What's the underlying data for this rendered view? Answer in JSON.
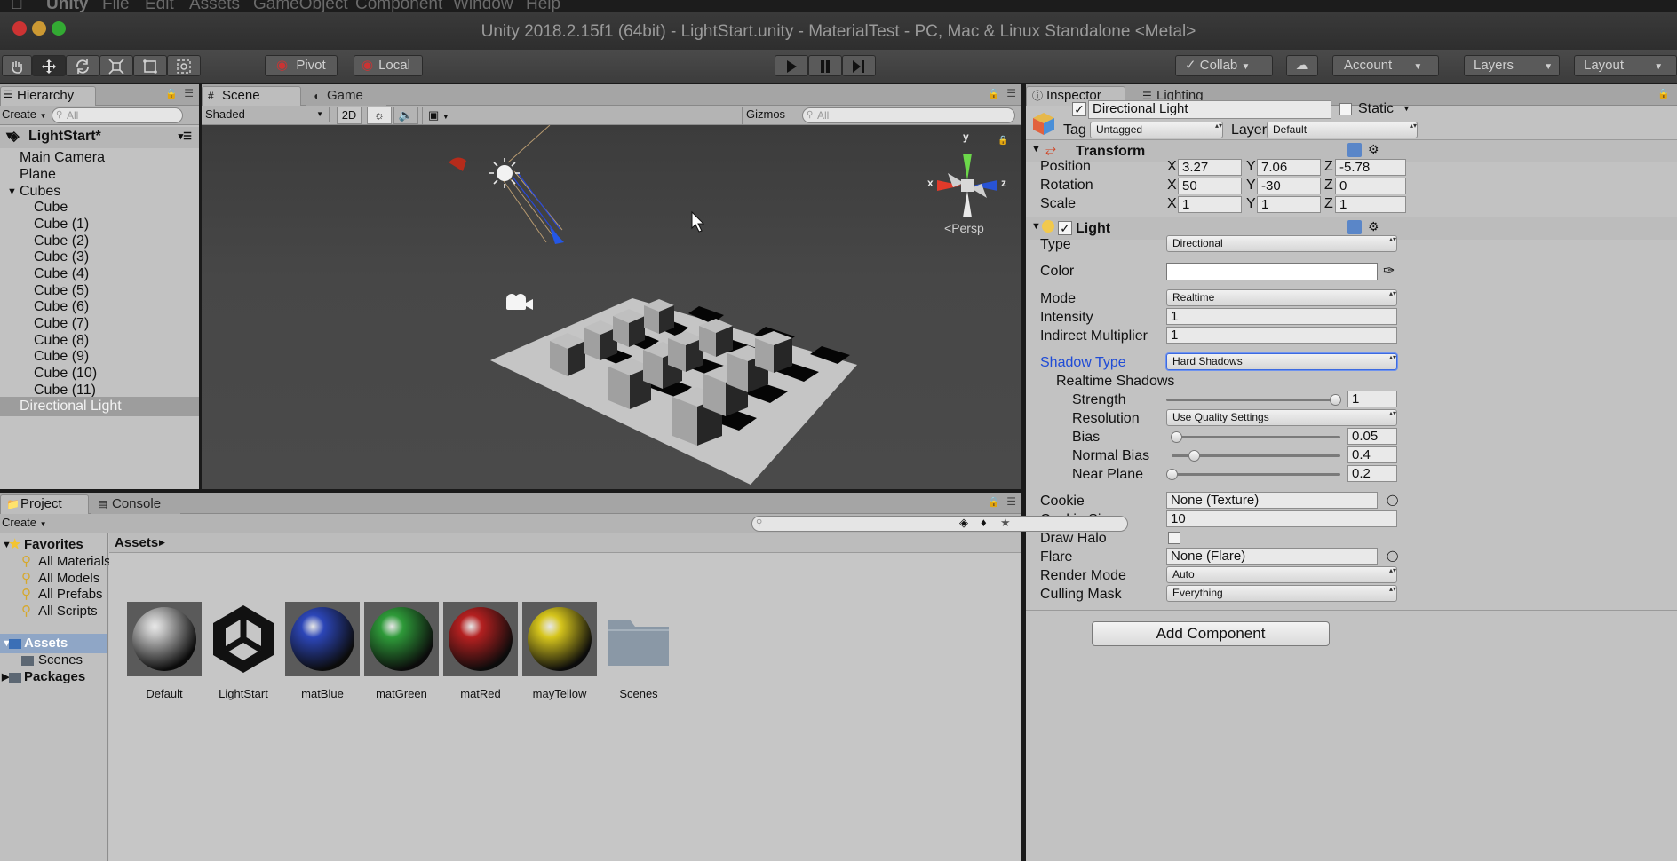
{
  "menubar": {
    "app": "Unity",
    "items": [
      "File",
      "Edit",
      "Assets",
      "GameObject",
      "Component",
      "Window",
      "Help"
    ]
  },
  "window": {
    "title": "Unity 2018.2.15f1 (64bit) - LightStart.unity - MaterialTest - PC, Mac & Linux Standalone <Metal>"
  },
  "toolbar": {
    "pivot": "Pivot",
    "local": "Local",
    "collab": "Collab",
    "account": "Account",
    "layers": "Layers",
    "layout": "Layout"
  },
  "hierarchy": {
    "tab": "Hierarchy",
    "create": "Create",
    "search_placeholder": "All",
    "scene": "LightStart*",
    "items": [
      "Main Camera",
      "Plane",
      "Cubes",
      "Cube",
      "Cube (1)",
      "Cube (2)",
      "Cube (3)",
      "Cube (4)",
      "Cube (5)",
      "Cube (6)",
      "Cube (7)",
      "Cube (8)",
      "Cube (9)",
      "Cube (10)",
      "Cube (11)",
      "Directional Light"
    ],
    "selected": "Directional Light"
  },
  "scene": {
    "tabs": [
      "Scene",
      "Game"
    ],
    "draw_mode": "Shaded",
    "mode_2d": "2D",
    "gizmos": "Gizmos",
    "search_placeholder": "All",
    "gizmo_axes": {
      "y": "y",
      "x": "x",
      "z": "z"
    },
    "persp": "Persp"
  },
  "inspector": {
    "tabs": [
      "Inspector",
      "Lighting"
    ],
    "object_name": "Directional Light",
    "static": "Static",
    "tag_label": "Tag",
    "tag_value": "Untagged",
    "layer_label": "Layer",
    "layer_value": "Default",
    "transform": {
      "title": "Transform",
      "position": {
        "label": "Position",
        "x": "3.27",
        "y": "7.06",
        "z": "-5.78"
      },
      "rotation": {
        "label": "Rotation",
        "x": "50",
        "y": "-30",
        "z": "0"
      },
      "scale": {
        "label": "Scale",
        "x": "1",
        "y": "1",
        "z": "1"
      },
      "axes": [
        "X",
        "Y",
        "Z"
      ]
    },
    "light": {
      "title": "Light",
      "type_label": "Type",
      "type_value": "Directional",
      "color_label": "Color",
      "mode_label": "Mode",
      "mode_value": "Realtime",
      "intensity_label": "Intensity",
      "intensity_value": "1",
      "indirect_label": "Indirect Multiplier",
      "indirect_value": "1",
      "shadow_type_label": "Shadow Type",
      "shadow_type_value": "Hard Shadows",
      "realtime_shadows": "Realtime Shadows",
      "strength_label": "Strength",
      "strength_value": "1",
      "resolution_label": "Resolution",
      "resolution_value": "Use Quality Settings",
      "bias_label": "Bias",
      "bias_value": "0.05",
      "normal_bias_label": "Normal Bias",
      "normal_bias_value": "0.4",
      "near_plane_label": "Near Plane",
      "near_plane_value": "0.2",
      "cookie_label": "Cookie",
      "cookie_value": "None (Texture)",
      "cookie_size_label": "Cookie Size",
      "cookie_size_value": "10",
      "draw_halo_label": "Draw Halo",
      "flare_label": "Flare",
      "flare_value": "None (Flare)",
      "render_mode_label": "Render Mode",
      "render_mode_value": "Auto",
      "culling_mask_label": "Culling Mask",
      "culling_mask_value": "Everything",
      "slider_levels": {
        "strength": 1.0,
        "bias": 0.025,
        "normal_bias": 0.133,
        "near_plane": 0.0
      }
    },
    "add_component": "Add Component"
  },
  "project": {
    "tabs": [
      "Project",
      "Console"
    ],
    "create": "Create",
    "favorites": {
      "title": "Favorites",
      "items": [
        "All Materials",
        "All Models",
        "All Prefabs",
        "All Scripts"
      ]
    },
    "tree": {
      "assets": "Assets",
      "scenes": "Scenes",
      "packages": "Packages"
    },
    "breadcrumb": "Assets",
    "assets": [
      {
        "name": "Default",
        "kind": "material",
        "color": "#b9b9b9"
      },
      {
        "name": "LightStart",
        "kind": "unity-scene",
        "color": "#1a1a1a"
      },
      {
        "name": "matBlue",
        "kind": "material",
        "color": "#2c46b8"
      },
      {
        "name": "matGreen",
        "kind": "material",
        "color": "#2e9a39"
      },
      {
        "name": "matRed",
        "kind": "material",
        "color": "#b42020"
      },
      {
        "name": "mayTellow",
        "kind": "material",
        "color": "#d6c51c"
      },
      {
        "name": "Scenes",
        "kind": "folder",
        "color": "#8a98a6"
      }
    ]
  },
  "colors": {
    "selection": "#8fa6c6",
    "link_blue": "#1f4bd6",
    "panel": "#c2c2c2"
  }
}
